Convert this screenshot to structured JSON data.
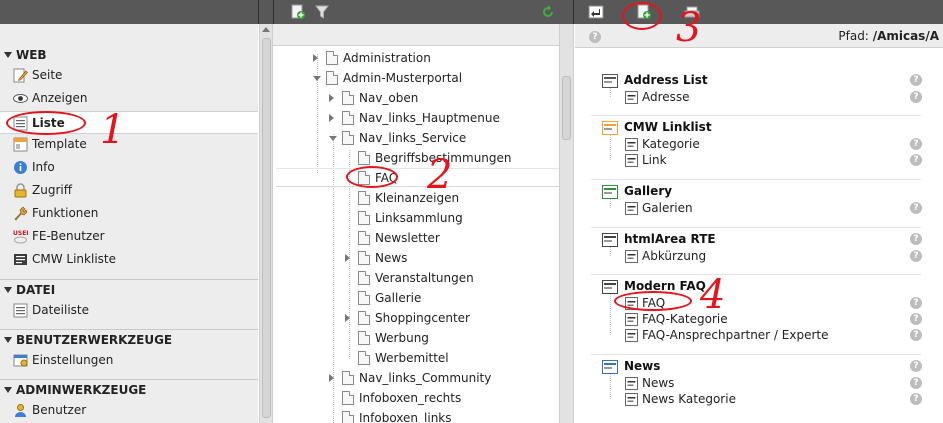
{
  "toolbar": {
    "icons": [
      "new-page-icon",
      "filter-icon",
      "refresh-icon",
      "back-icon",
      "new-record-icon",
      "print-icon"
    ]
  },
  "module_menu": {
    "sections": [
      {
        "title": "WEB",
        "items": [
          {
            "label": "Seite",
            "icon": "page-icon"
          },
          {
            "label": "Anzeigen",
            "icon": "eye-icon"
          },
          {
            "label": "Liste",
            "icon": "list-icon",
            "active": true
          },
          {
            "label": "Template",
            "icon": "template-icon"
          },
          {
            "label": "Info",
            "icon": "info-icon"
          },
          {
            "label": "Zugriff",
            "icon": "lock-icon"
          },
          {
            "label": "Funktionen",
            "icon": "wrench-icon"
          },
          {
            "label": "FE-Benutzer",
            "icon": "user-online-icon"
          },
          {
            "label": "CMW Linkliste",
            "icon": "linklist-icon"
          }
        ]
      },
      {
        "title": "DATEI",
        "items": [
          {
            "label": "Dateiliste",
            "icon": "filelist-icon"
          }
        ]
      },
      {
        "title": "BENUTZERWERKZEUGE",
        "items": [
          {
            "label": "Einstellungen",
            "icon": "settings-icon"
          }
        ]
      },
      {
        "title": "ADMINWERKZEUGE",
        "items": [
          {
            "label": "Benutzer",
            "icon": "users-icon"
          }
        ]
      }
    ]
  },
  "page_tree": {
    "rows": [
      {
        "label": "Administration",
        "level": 0,
        "exp": "closed"
      },
      {
        "label": "Admin-Musterportal",
        "level": 0,
        "exp": "open"
      },
      {
        "label": "Nav_oben",
        "level": 1,
        "exp": "closed"
      },
      {
        "label": "Nav_links_Hauptmenue",
        "level": 1,
        "exp": "closed"
      },
      {
        "label": "Nav_links_Service",
        "level": 1,
        "exp": "open"
      },
      {
        "label": "Begriffsbestimmungen",
        "level": 2,
        "exp": "none"
      },
      {
        "label": "FAQ",
        "level": 2,
        "exp": "none"
      },
      {
        "label": "Kleinanzeigen",
        "level": 2,
        "exp": "none"
      },
      {
        "label": "Linksammlung",
        "level": 2,
        "exp": "none"
      },
      {
        "label": "Newsletter",
        "level": 2,
        "exp": "none"
      },
      {
        "label": "News",
        "level": 2,
        "exp": "closed"
      },
      {
        "label": "Veranstaltungen",
        "level": 2,
        "exp": "none"
      },
      {
        "label": "Gallerie",
        "level": 2,
        "exp": "none"
      },
      {
        "label": "Shoppingcenter",
        "level": 2,
        "exp": "closed"
      },
      {
        "label": "Werbung",
        "level": 2,
        "exp": "none"
      },
      {
        "label": "Werbemittel",
        "level": 2,
        "exp": "none"
      },
      {
        "label": "Nav_links_Community",
        "level": 1,
        "exp": "closed"
      },
      {
        "label": "Infoboxen_rechts",
        "level": 1,
        "exp": "none"
      },
      {
        "label": "Infoboxen_links",
        "level": 1,
        "exp": "none"
      }
    ]
  },
  "content": {
    "path_label": "Pfad:",
    "path_value": "/Amicas/A",
    "groups": [
      {
        "title": "Address List",
        "icon": "address-list-icon",
        "items": [
          {
            "label": "Adresse",
            "icon": "address-icon"
          }
        ]
      },
      {
        "title": "CMW Linklist",
        "icon": "cmw-linklist-icon",
        "items": [
          {
            "label": "Kategorie",
            "icon": "category-icon"
          },
          {
            "label": "Link",
            "icon": "link-icon"
          }
        ]
      },
      {
        "title": "Gallery",
        "icon": "gallery-icon",
        "items": [
          {
            "label": "Galerien",
            "icon": "galleries-icon"
          }
        ]
      },
      {
        "title": "htmlArea RTE",
        "icon": "rte-icon",
        "items": [
          {
            "label": "Abkürzung",
            "icon": "abbreviation-icon"
          }
        ]
      },
      {
        "title": "Modern FAQ",
        "icon": "faq-icon",
        "items": [
          {
            "label": "FAQ",
            "icon": "faq-item-icon"
          },
          {
            "label": "FAQ-Kategorie",
            "icon": "faq-category-icon"
          },
          {
            "label": "FAQ-Ansprechpartner / Experte",
            "icon": "faq-expert-icon"
          }
        ]
      },
      {
        "title": "News",
        "icon": "news-icon",
        "items": [
          {
            "label": "News",
            "icon": "news-item-icon"
          },
          {
            "label": "News Kategorie",
            "icon": "news-category-icon"
          }
        ]
      }
    ]
  },
  "annotations": [
    "1",
    "2",
    "3",
    "4"
  ],
  "colors": {
    "annotation": "#e8131a",
    "topbar": "#585858",
    "menu_bg": "#ededed"
  }
}
